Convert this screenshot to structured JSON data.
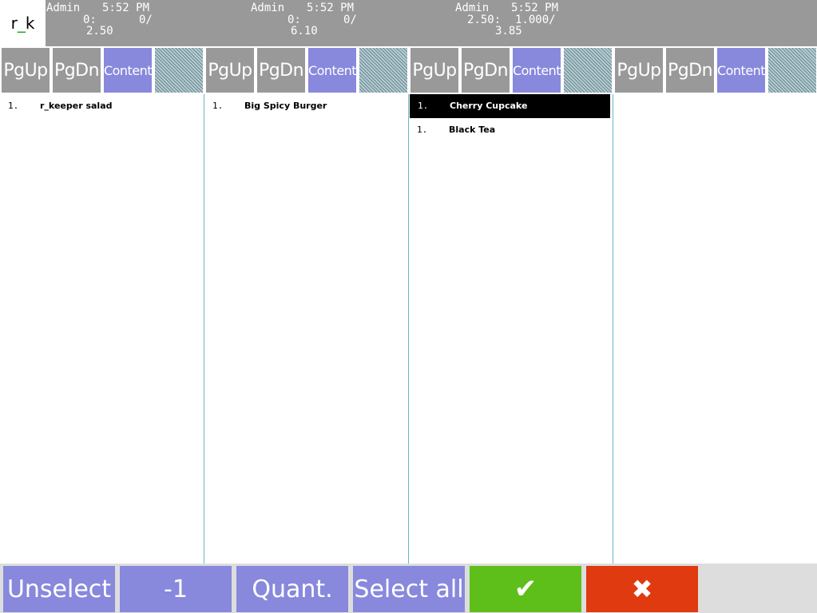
{
  "logo": {
    "part1": "r",
    "part2": "_",
    "part3": "k"
  },
  "orders": [
    {
      "user": "Admin",
      "time": "5:52 PM",
      "l2a": "0:",
      "l2b": "0/",
      "total": "2.50"
    },
    {
      "user": "Admin",
      "time": "5:52 PM",
      "l2a": "0:",
      "l2b": "0/",
      "total": "6.10"
    },
    {
      "user": "Admin",
      "time": "5:52 PM",
      "l2a": "2.50:",
      "l2b": "1.000/",
      "total": "3.85"
    }
  ],
  "nav": {
    "pgup": "PgUp",
    "pgdn": "PgDn",
    "content": "Content"
  },
  "columns": [
    {
      "items": [
        {
          "num": "1.",
          "name": "r_keeper salad",
          "selected": false
        }
      ]
    },
    {
      "items": [
        {
          "num": "1.",
          "name": "Big Spicy Burger",
          "selected": false
        }
      ]
    },
    {
      "items": [
        {
          "num": "1.",
          "name": "Cherry Cupcake",
          "selected": true
        },
        {
          "num": "1.",
          "name": "Black Tea",
          "selected": false
        }
      ]
    },
    {
      "items": []
    }
  ],
  "actions": {
    "unselect": "Unselect",
    "minus_one": "-1",
    "quant": "Quant.",
    "select_all": "Select all",
    "ok_icon": "✔",
    "cancel_icon": "✖"
  },
  "colors": {
    "header_bg": "#999999",
    "button_purple": "#8888dd",
    "ok_green": "#5fbf1a",
    "cancel_red": "#e03a10",
    "divider": "#67b8c6"
  }
}
